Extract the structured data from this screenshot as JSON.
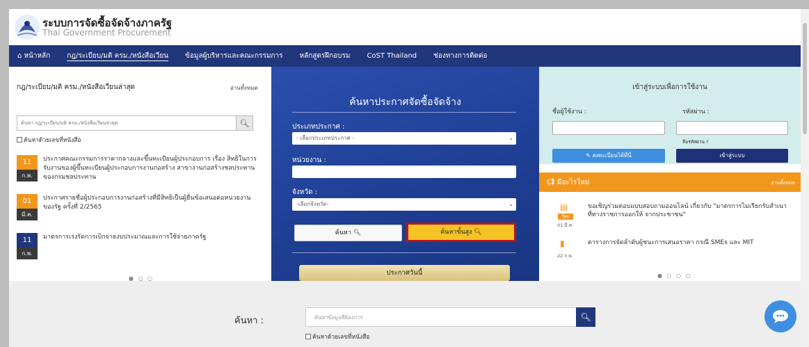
{
  "header": {
    "title_th": "ระบบการจัดซื้อจัดจ้างภาครัฐ",
    "title_en": "Thai Government Procurement"
  },
  "nav": {
    "items": [
      {
        "label": "หน้าหลัก"
      },
      {
        "label": "กฎ/ระเบียบ/มติ ครม./หนังสือเวียน"
      },
      {
        "label": "ข้อมูลผู้บริหารและคณะกรรมการ"
      },
      {
        "label": "หลักสูตรฝึกอบรม"
      },
      {
        "label": "CoST Thailand"
      },
      {
        "label": "ช่องทางการติดต่อ"
      }
    ]
  },
  "left_panel": {
    "title": "กฎ/ระเบียบ/มติ ครม./หนังสือเวียนล่าสุด",
    "view_all": "อ่านทั้งหมด",
    "search_placeholder": "ค้นหา กฎ/ระเบียบ/มติ ครม./หนังสือเวียนล่าสุด",
    "checkbox_label": "ค้นหาด้วยเลขที่หนังสือ",
    "news": [
      {
        "day": "11",
        "month": "ก.พ.",
        "color": "#f2971e",
        "text": "ประกาศคณะกรรมการราคากลางและขึ้นทะเบียนผู้ประกอบการ เรื่อง สิทธิในการรับงานของผู้ขึ้นทะเบียนผู้ประกอบการงานก่อสร้าง สาขางานก่อสร้างชลประทาน ของกรมชลประทาน"
      },
      {
        "day": "01",
        "month": "มี.ค.",
        "color": "#f2971e",
        "text": "ประกาศรายชื่อผู้ประกอบการงานก่อสร้างที่มีสิทธิเป็นผู้ยื่นข้อเสนอต่อหน่วยงานของรัฐ ครั้งที่ 2/2565"
      },
      {
        "day": "11",
        "month": "ก.พ.",
        "color": "#22367c",
        "text": "มาตรการเร่งรัดการเบิกจ่ายงบประมาณและการใช้จ่ายภาครัฐ"
      }
    ],
    "pager": "● ○ ○"
  },
  "center_panel": {
    "title": "ค้นหาประกาศจัดซื้อจัดจ้าง",
    "type_label": "ประเภทประกาศ :",
    "type_value": "- เลือกประเภทประกาศ -",
    "agency_label": "หน่วยงาน :",
    "province_label": "จังหวัด :",
    "province_value": "-เลือกจังหวัด-",
    "search_btn": "ค้นหา",
    "advanced_btn": "ค้นหาขั้นสูง",
    "today_btn": "ประกาศวันนี้"
  },
  "right_panel": {
    "login_title": "เข้าสู่ระบบเพื่อการใช้งาน",
    "username_label": "ชื่อผู้ใช้งาน :",
    "password_label": "รหัสผ่าน :",
    "forgot": "ลืมรหัสผ่าน ?",
    "register_btn": "ลงทะเบียนได้ที่นี่",
    "login_btn": "เข้าสู่ระบบ",
    "whatsnew_title": "มีอะไรใหม่",
    "whatsnew_all": "อ่านทั้งหมด",
    "items": [
      {
        "badge": "ใหม่",
        "date": "01 มี.ค.",
        "text": "ขอเชิญร่วมตอบแบบสอบถามออนไลน์ เกี่ยวกับ \"มาตรการไม่เรียกรับสำเนาที่ทางราชการออกให้ จากประชาชน\""
      },
      {
        "date": "22 ก.พ.",
        "text": "ตารางการจัดลำดับผู้ชนะการเสนอราคา กรณี SMEs และ MIT"
      }
    ],
    "pager": "● ○ ○ ○"
  },
  "bottom": {
    "label": "ค้นหา :",
    "placeholder": "ค้นหาข้อมูลที่ต้องการ",
    "checkbox_label": "ค้นหาด้วยเลขที่หนังสือ"
  }
}
